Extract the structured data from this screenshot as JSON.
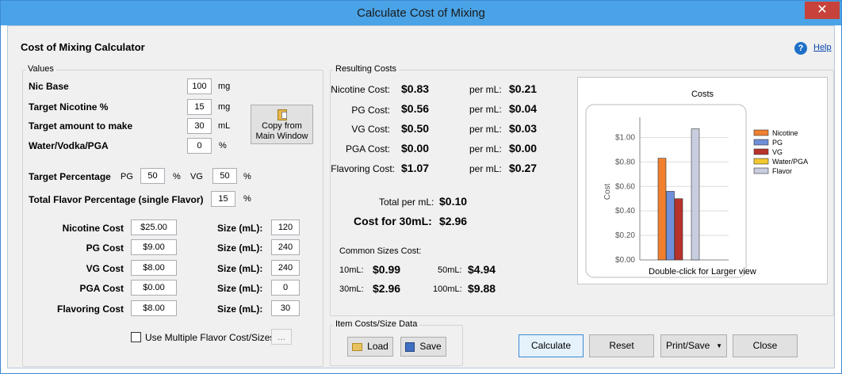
{
  "window": {
    "title": "Calculate Cost of Mixing",
    "close": "✕"
  },
  "header": {
    "title": "Cost of Mixing Calculator",
    "help_label": "Help"
  },
  "values": {
    "group_label": "Values",
    "nic_base": {
      "label": "Nic Base",
      "value": "100",
      "unit": "mg"
    },
    "target_nicotine": {
      "label": "Target Nicotine %",
      "value": "15",
      "unit": "mg"
    },
    "target_amount": {
      "label": "Target amount to make",
      "value": "30",
      "unit": "mL"
    },
    "water": {
      "label": "Water/Vodka/PGA",
      "value": "0",
      "unit": "%"
    },
    "copy_button": "Copy from Main Window",
    "target_percentage": {
      "label": "Target Percentage",
      "pg_label": "PG",
      "pg_value": "50",
      "pg_unit": "%",
      "vg_label": "VG",
      "vg_value": "50",
      "vg_unit": "%"
    },
    "total_flavor": {
      "label": "Total Flavor Percentage (single Flavor)",
      "value": "15",
      "unit": "%"
    },
    "costs": [
      {
        "label": "Nicotine Cost",
        "cost": "$25.00",
        "size_label": "Size (mL):",
        "size": "120"
      },
      {
        "label": "PG Cost",
        "cost": "$9.00",
        "size_label": "Size (mL):",
        "size": "240"
      },
      {
        "label": "VG Cost",
        "cost": "$8.00",
        "size_label": "Size (mL):",
        "size": "240"
      },
      {
        "label": "PGA Cost",
        "cost": "$0.00",
        "size_label": "Size (mL):",
        "size": "0"
      },
      {
        "label": "Flavoring Cost",
        "cost": "$8.00",
        "size_label": "Size (mL):",
        "size": "30"
      }
    ],
    "multi_flavor_label": "Use Multiple Flavor Cost/Sizes",
    "ellipsis": "..."
  },
  "results": {
    "group_label": "Resulting Costs",
    "rows": [
      {
        "label": "Nicotine Cost:",
        "value": "$0.83",
        "per_label": "per mL:",
        "per_value": "$0.21"
      },
      {
        "label": "PG Cost:",
        "value": "$0.56",
        "per_label": "per mL:",
        "per_value": "$0.04"
      },
      {
        "label": "VG Cost:",
        "value": "$0.50",
        "per_label": "per mL:",
        "per_value": "$0.03"
      },
      {
        "label": "PGA Cost:",
        "value": "$0.00",
        "per_label": "per mL:",
        "per_value": "$0.00"
      },
      {
        "label": "Flavoring Cost:",
        "value": "$1.07",
        "per_label": "per mL:",
        "per_value": "$0.27"
      }
    ],
    "total_per_ml_label": "Total per mL:",
    "total_per_ml": "$0.10",
    "cost_for_label": "Cost for 30mL:",
    "cost_for": "$2.96",
    "common_label": "Common Sizes Cost:",
    "common": [
      {
        "label": "10mL:",
        "value": "$0.99"
      },
      {
        "label": "50mL:",
        "value": "$4.94"
      },
      {
        "label": "30mL:",
        "value": "$2.96"
      },
      {
        "label": "100mL:",
        "value": "$9.88"
      }
    ],
    "chart_caption": "Double-click for Larger view"
  },
  "chart_data": {
    "type": "bar",
    "title": "Costs",
    "ylabel": "Cost",
    "ylim": [
      0,
      1.1
    ],
    "yticks": [
      "$0.00",
      "$0.20",
      "$0.40",
      "$0.60",
      "$0.80",
      "$1.00"
    ],
    "ytick_values": [
      0,
      0.2,
      0.4,
      0.6,
      0.8,
      1.0
    ],
    "grid": true,
    "legend": "right",
    "series": [
      {
        "name": "Nicotine",
        "value": 0.83,
        "color": "#f07f2e"
      },
      {
        "name": "PG",
        "value": 0.56,
        "color": "#6f8fd8"
      },
      {
        "name": "VG",
        "value": 0.5,
        "color": "#b8312b"
      },
      {
        "name": "Water/PGA",
        "value": 0.0,
        "color": "#f3c82e"
      },
      {
        "name": "Flavor",
        "value": 1.07,
        "color": "#c9cde0"
      }
    ]
  },
  "item_data": {
    "group_label": "Item Costs/Size Data",
    "load": "Load",
    "save": "Save"
  },
  "footer": {
    "calculate": "Calculate",
    "reset": "Reset",
    "print_save": "Print/Save",
    "close": "Close"
  },
  "colors": {
    "titlebar": "#4aa3e6",
    "close": "#c7423a",
    "help_icon": "#1e6fc8"
  }
}
